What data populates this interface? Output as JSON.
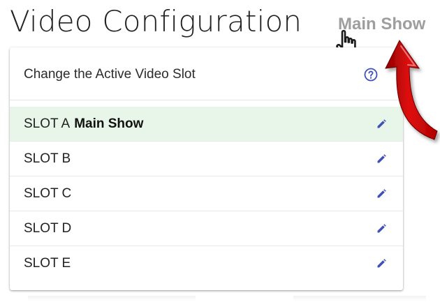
{
  "header": {
    "title": "Video Configuration",
    "show_label": "Main Show"
  },
  "card": {
    "title": "Change the Active Video Slot",
    "help_icon": "help-circle-icon"
  },
  "slots": [
    {
      "label": "SLOT A",
      "name": "Main Show",
      "active": true,
      "icon": "pencil-icon"
    },
    {
      "label": "SLOT B",
      "name": "",
      "active": false,
      "icon": "pencil-icon"
    },
    {
      "label": "SLOT C",
      "name": "",
      "active": false,
      "icon": "pencil-icon"
    },
    {
      "label": "SLOT D",
      "name": "",
      "active": false,
      "icon": "pencil-icon"
    },
    {
      "label": "SLOT E",
      "name": "",
      "active": false,
      "icon": "pencil-icon"
    }
  ],
  "colors": {
    "active_row": "#e8f5e9",
    "accent_icon": "#3f51b5",
    "annotation_arrow": "#d50000",
    "show_label": "#9e9e9e"
  }
}
